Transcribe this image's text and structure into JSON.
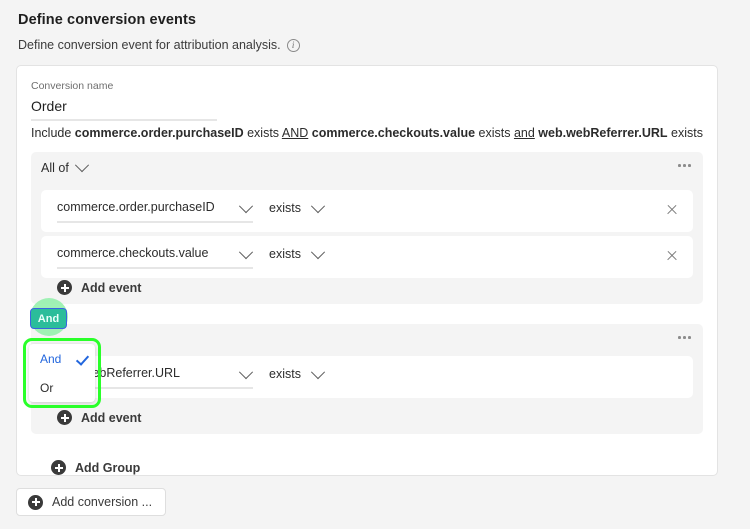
{
  "header": {
    "title": "Define conversion events",
    "subtitle": "Define conversion event for attribution analysis.",
    "info_icon": "info-icon"
  },
  "conversion": {
    "name_label": "Conversion name",
    "name_value": "Order",
    "summary": {
      "prefix": "Include",
      "parts": [
        {
          "field": "commerce.order.purchaseID",
          "operator": "exists",
          "conjunction": "AND"
        },
        {
          "field": "commerce.checkouts.value",
          "operator": "exists",
          "conjunction": "and"
        },
        {
          "field": "web.webReferrer.URL",
          "operator": "exists",
          "conjunction": ""
        }
      ]
    }
  },
  "groups": [
    {
      "match_label": "All of",
      "menu_icon": "kebab-menu-icon",
      "events": [
        {
          "field": "commerce.order.purchaseID",
          "operator": "exists",
          "close_icon": "close-icon"
        },
        {
          "field": "commerce.checkouts.value",
          "operator": "exists",
          "close_icon": "close-icon"
        }
      ],
      "add_event_label": "Add event"
    },
    {
      "match_label": "",
      "menu_icon": "kebab-menu-icon",
      "events": [
        {
          "field": "web.webReferrer.URL",
          "operator": "exists",
          "close_icon": ""
        }
      ],
      "add_event_label": "Add event"
    }
  ],
  "conjunction": {
    "chip_label": "And",
    "menu_open": true,
    "options": [
      {
        "label": "And",
        "selected": true
      },
      {
        "label": "Or",
        "selected": false
      }
    ]
  },
  "actions": {
    "add_group_label": "Add Group",
    "add_conversion_label": "Add conversion ..."
  },
  "colors": {
    "page_background": "#f4f4f4",
    "card_background": "#ffffff",
    "group_background": "#f4f4f4",
    "chip_fill": "#2bbd9a",
    "chip_border": "#3b63e0",
    "highlight_green": "#2aff2a",
    "halo_green": "#8ff0a8",
    "selected_blue": "#2266dd"
  }
}
